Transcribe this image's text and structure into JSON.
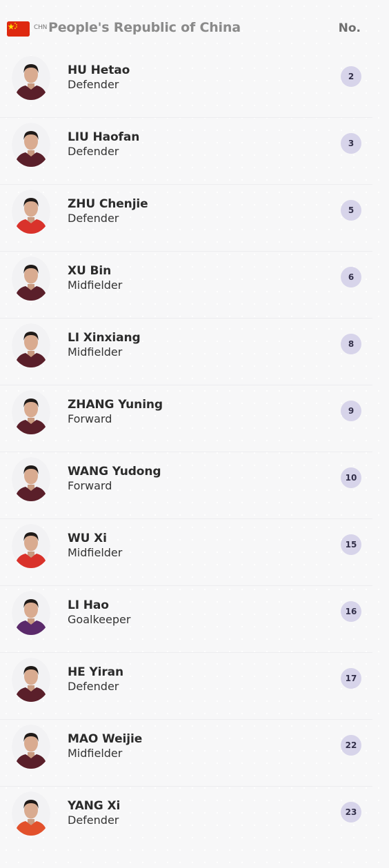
{
  "team": {
    "code": "CHN",
    "name": "People's Republic of China",
    "number_header": "No.",
    "flag_color": "#de2910",
    "star_color": "#ffde00"
  },
  "players": [
    {
      "name": "HU Hetao",
      "position": "Defender",
      "number": "2",
      "kit": "dark"
    },
    {
      "name": "LIU Haofan",
      "position": "Defender",
      "number": "3",
      "kit": "dark"
    },
    {
      "name": "ZHU Chenjie",
      "position": "Defender",
      "number": "5",
      "kit": "red"
    },
    {
      "name": "XU Bin",
      "position": "Midfielder",
      "number": "6",
      "kit": "dark"
    },
    {
      "name": "LI Xinxiang",
      "position": "Midfielder",
      "number": "8",
      "kit": "dark"
    },
    {
      "name": "ZHANG Yuning",
      "position": "Forward",
      "number": "9",
      "kit": "dark"
    },
    {
      "name": "WANG Yudong",
      "position": "Forward",
      "number": "10",
      "kit": "dark"
    },
    {
      "name": "WU Xi",
      "position": "Midfielder",
      "number": "15",
      "kit": "red"
    },
    {
      "name": "LI Hao",
      "position": "Goalkeeper",
      "number": "16",
      "kit": "purple"
    },
    {
      "name": "HE Yiran",
      "position": "Defender",
      "number": "17",
      "kit": "dark"
    },
    {
      "name": "MAO Weijie",
      "position": "Midfielder",
      "number": "22",
      "kit": "dark"
    },
    {
      "name": "YANG Xi",
      "position": "Defender",
      "number": "23",
      "kit": "orange"
    }
  ],
  "kit_colors": {
    "dark": "#5a1f2a",
    "red": "#d9322b",
    "purple": "#5b2a6b",
    "orange": "#e2512c"
  },
  "number_badge_color": "#d7d4ea"
}
